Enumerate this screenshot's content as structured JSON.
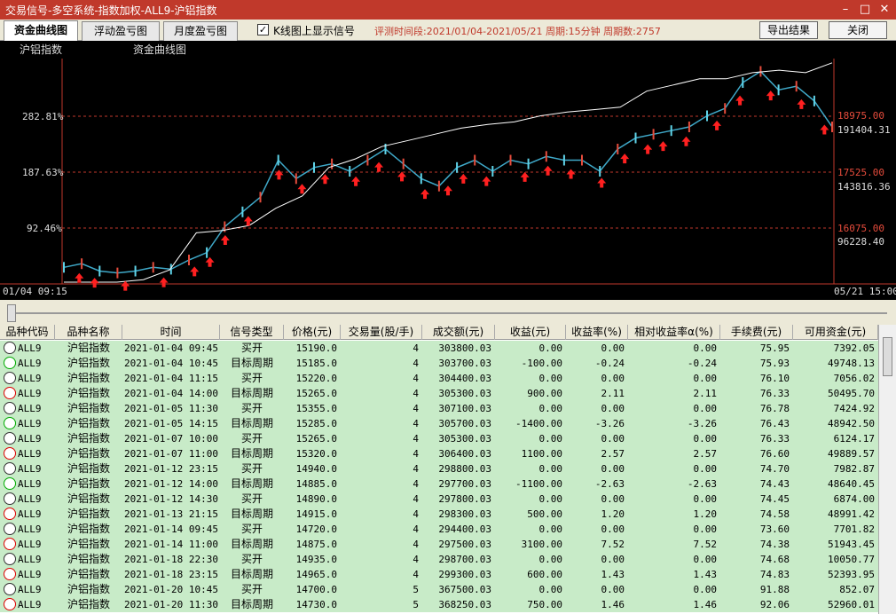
{
  "window": {
    "title": "交易信号-多空系统-指数加权-ALL9-沪铝指数"
  },
  "toolbar": {
    "tabs": [
      "资金曲线图",
      "浮动盈亏图",
      "月度盈亏图"
    ],
    "show_signals_checked": true,
    "show_signals_label": "K线图上显示信号",
    "info": "评测时间段:2021/01/04-2021/05/21  周期:15分钟  周期数:2757",
    "export_label": "导出结果",
    "close_label": "关闭"
  },
  "chart_data": {
    "type": "line",
    "title_left": "沪铝指数",
    "title_center": "资金曲线图",
    "x_start_label": "01/04 09:15",
    "x_end_label": "05/21 15:00",
    "left_ticks": [
      "282.81%",
      "187.63%",
      "92.46%"
    ],
    "price_levels": [
      "18975.00",
      "17525.00",
      "16075.00"
    ],
    "equity_labels": [
      "191404.31",
      "143816.36",
      "96228.40"
    ],
    "price_range": [
      14400,
      20400
    ],
    "equity_range": [
      50000,
      230000
    ],
    "price_series": [
      14800,
      14900,
      14700,
      14650,
      14700,
      14800,
      14750,
      15000,
      15200,
      15900,
      16300,
      16700,
      17700,
      17200,
      17500,
      17600,
      17400,
      17700,
      18000,
      17600,
      17200,
      17000,
      17500,
      17700,
      17400,
      17700,
      17600,
      17800,
      17700,
      17700,
      17400,
      18000,
      18300,
      18400,
      18500,
      18600,
      18900,
      19100,
      19800,
      20100,
      19600,
      19700,
      19300,
      18600
    ],
    "equity_series": [
      50000,
      50000,
      50000,
      52000,
      60000,
      90000,
      92000,
      96000,
      110000,
      120000,
      143000,
      150000,
      160000,
      165000,
      170000,
      175000,
      178000,
      180000,
      185000,
      188000,
      190000,
      192000,
      205000,
      210000,
      215000,
      215000,
      220000,
      222000,
      220000,
      228000
    ],
    "buy_signal_positions": [
      0.02,
      0.04,
      0.08,
      0.13,
      0.17,
      0.19,
      0.21,
      0.24,
      0.28,
      0.31,
      0.34,
      0.38,
      0.41,
      0.44,
      0.47,
      0.5,
      0.52,
      0.55,
      0.6,
      0.63,
      0.66,
      0.7,
      0.73,
      0.76,
      0.78,
      0.81,
      0.85,
      0.88,
      0.92,
      0.96,
      0.99
    ]
  },
  "table": {
    "columns": [
      "品种代码",
      "品种名称",
      "时间",
      "信号类型",
      "价格(元)",
      "交易量(股/手)",
      "成交额(元)",
      "收益(元)",
      "收益率(%)",
      "相对收益率α(%)",
      "手续费(元)",
      "可用资金(元)"
    ],
    "rows": [
      {
        "face": "neutral",
        "code": "ALL9",
        "name": "沪铝指数",
        "time": "2021-01-04 09:45",
        "type": "买开",
        "price": "15190.0",
        "vol": "4",
        "amount": "303800.03",
        "profit": "0.00",
        "rate": "0.00",
        "alpha": "0.00",
        "fee": "75.95",
        "cash": "7392.05"
      },
      {
        "face": "loss",
        "code": "ALL9",
        "name": "沪铝指数",
        "time": "2021-01-04 10:45",
        "type": "目标周期",
        "price": "15185.0",
        "vol": "4",
        "amount": "303700.03",
        "profit": "-100.00",
        "rate": "-0.24",
        "alpha": "-0.24",
        "fee": "75.93",
        "cash": "49748.13"
      },
      {
        "face": "neutral",
        "code": "ALL9",
        "name": "沪铝指数",
        "time": "2021-01-04 11:15",
        "type": "买开",
        "price": "15220.0",
        "vol": "4",
        "amount": "304400.03",
        "profit": "0.00",
        "rate": "0.00",
        "alpha": "0.00",
        "fee": "76.10",
        "cash": "7056.02"
      },
      {
        "face": "win",
        "code": "ALL9",
        "name": "沪铝指数",
        "time": "2021-01-04 14:00",
        "type": "目标周期",
        "price": "15265.0",
        "vol": "4",
        "amount": "305300.03",
        "profit": "900.00",
        "rate": "2.11",
        "alpha": "2.11",
        "fee": "76.33",
        "cash": "50495.70"
      },
      {
        "face": "neutral",
        "code": "ALL9",
        "name": "沪铝指数",
        "time": "2021-01-05 11:30",
        "type": "买开",
        "price": "15355.0",
        "vol": "4",
        "amount": "307100.03",
        "profit": "0.00",
        "rate": "0.00",
        "alpha": "0.00",
        "fee": "76.78",
        "cash": "7424.92"
      },
      {
        "face": "loss",
        "code": "ALL9",
        "name": "沪铝指数",
        "time": "2021-01-05 14:15",
        "type": "目标周期",
        "price": "15285.0",
        "vol": "4",
        "amount": "305700.03",
        "profit": "-1400.00",
        "rate": "-3.26",
        "alpha": "-3.26",
        "fee": "76.43",
        "cash": "48942.50"
      },
      {
        "face": "neutral",
        "code": "ALL9",
        "name": "沪铝指数",
        "time": "2021-01-07 10:00",
        "type": "买开",
        "price": "15265.0",
        "vol": "4",
        "amount": "305300.03",
        "profit": "0.00",
        "rate": "0.00",
        "alpha": "0.00",
        "fee": "76.33",
        "cash": "6124.17"
      },
      {
        "face": "win",
        "code": "ALL9",
        "name": "沪铝指数",
        "time": "2021-01-07 11:00",
        "type": "目标周期",
        "price": "15320.0",
        "vol": "4",
        "amount": "306400.03",
        "profit": "1100.00",
        "rate": "2.57",
        "alpha": "2.57",
        "fee": "76.60",
        "cash": "49889.57"
      },
      {
        "face": "neutral",
        "code": "ALL9",
        "name": "沪铝指数",
        "time": "2021-01-12 23:15",
        "type": "买开",
        "price": "14940.0",
        "vol": "4",
        "amount": "298800.03",
        "profit": "0.00",
        "rate": "0.00",
        "alpha": "0.00",
        "fee": "74.70",
        "cash": "7982.87"
      },
      {
        "face": "loss",
        "code": "ALL9",
        "name": "沪铝指数",
        "time": "2021-01-12 14:00",
        "type": "目标周期",
        "price": "14885.0",
        "vol": "4",
        "amount": "297700.03",
        "profit": "-1100.00",
        "rate": "-2.63",
        "alpha": "-2.63",
        "fee": "74.43",
        "cash": "48640.45"
      },
      {
        "face": "neutral",
        "code": "ALL9",
        "name": "沪铝指数",
        "time": "2021-01-12 14:30",
        "type": "买开",
        "price": "14890.0",
        "vol": "4",
        "amount": "297800.03",
        "profit": "0.00",
        "rate": "0.00",
        "alpha": "0.00",
        "fee": "74.45",
        "cash": "6874.00"
      },
      {
        "face": "win",
        "code": "ALL9",
        "name": "沪铝指数",
        "time": "2021-01-13 21:15",
        "type": "目标周期",
        "price": "14915.0",
        "vol": "4",
        "amount": "298300.03",
        "profit": "500.00",
        "rate": "1.20",
        "alpha": "1.20",
        "fee": "74.58",
        "cash": "48991.42"
      },
      {
        "face": "neutral",
        "code": "ALL9",
        "name": "沪铝指数",
        "time": "2021-01-14 09:45",
        "type": "买开",
        "price": "14720.0",
        "vol": "4",
        "amount": "294400.03",
        "profit": "0.00",
        "rate": "0.00",
        "alpha": "0.00",
        "fee": "73.60",
        "cash": "7701.82"
      },
      {
        "face": "win",
        "code": "ALL9",
        "name": "沪铝指数",
        "time": "2021-01-14 11:00",
        "type": "目标周期",
        "price": "14875.0",
        "vol": "4",
        "amount": "297500.03",
        "profit": "3100.00",
        "rate": "7.52",
        "alpha": "7.52",
        "fee": "74.38",
        "cash": "51943.45"
      },
      {
        "face": "neutral",
        "code": "ALL9",
        "name": "沪铝指数",
        "time": "2021-01-18 22:30",
        "type": "买开",
        "price": "14935.0",
        "vol": "4",
        "amount": "298700.03",
        "profit": "0.00",
        "rate": "0.00",
        "alpha": "0.00",
        "fee": "74.68",
        "cash": "10050.77"
      },
      {
        "face": "win",
        "code": "ALL9",
        "name": "沪铝指数",
        "time": "2021-01-18 23:15",
        "type": "目标周期",
        "price": "14965.0",
        "vol": "4",
        "amount": "299300.03",
        "profit": "600.00",
        "rate": "1.43",
        "alpha": "1.43",
        "fee": "74.83",
        "cash": "52393.95"
      },
      {
        "face": "neutral",
        "code": "ALL9",
        "name": "沪铝指数",
        "time": "2021-01-20 10:45",
        "type": "买开",
        "price": "14700.0",
        "vol": "5",
        "amount": "367500.03",
        "profit": "0.00",
        "rate": "0.00",
        "alpha": "0.00",
        "fee": "91.88",
        "cash": "852.07"
      },
      {
        "face": "win",
        "code": "ALL9",
        "name": "沪铝指数",
        "time": "2021-01-20 11:30",
        "type": "目标周期",
        "price": "14730.0",
        "vol": "5",
        "amount": "368250.03",
        "profit": "750.00",
        "rate": "1.46",
        "alpha": "1.46",
        "fee": "92.06",
        "cash": "52960.01"
      }
    ]
  }
}
